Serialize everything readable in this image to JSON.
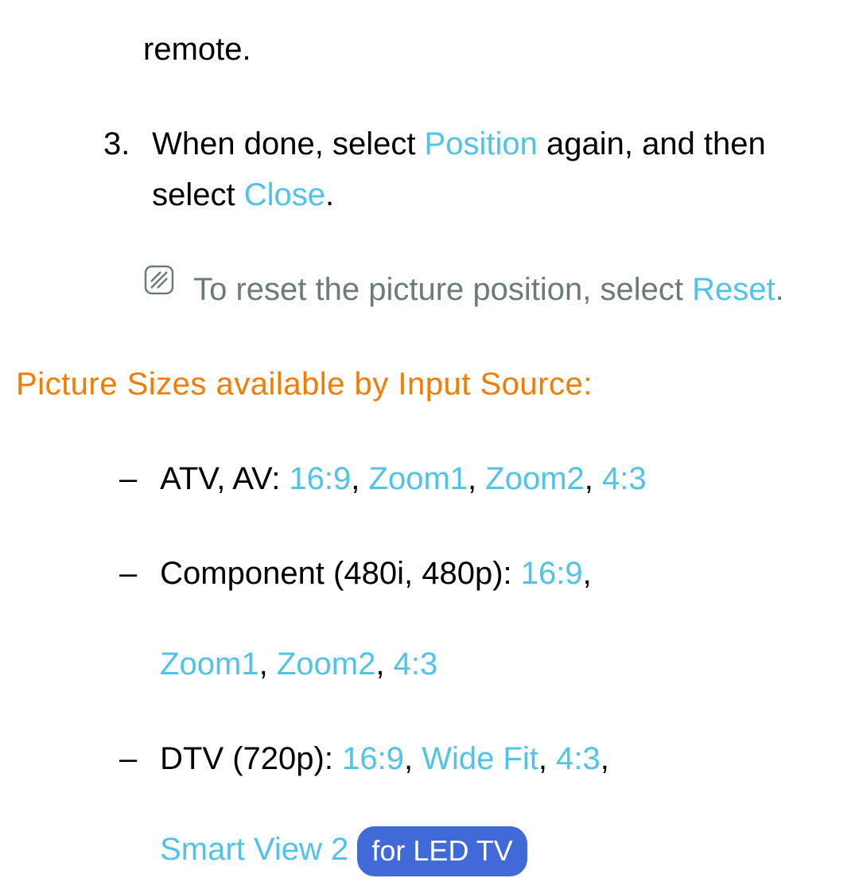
{
  "p0": "remote.",
  "step3_num": "3.",
  "step3_a": "When done, select ",
  "step3_pos": "Position",
  "step3_b": " again, and then select ",
  "step3_close": "Close",
  "step3_c": ".",
  "note_a": "To reset the picture position, select ",
  "note_reset": "Reset",
  "note_b": ".",
  "section_title": "Picture Sizes available by Input Source:",
  "dash": "–",
  "li1_a": "ATV, AV: ",
  "li1_v1": "16:9",
  "sep": ", ",
  "li1_v2": "Zoom1",
  "li1_v3": "Zoom2",
  "li1_v4": "4:3",
  "li2_a": "Component (480i, 480p): ",
  "li2_v1": "16:9",
  "li2_v2": "Zoom1",
  "li2_v3": "Zoom2",
  "li2_v4": "4:3",
  "li3_a": "DTV (720p): ",
  "li3_v1": "16:9",
  "li3_v2": "Wide Fit",
  "li3_v3": "4:3",
  "li3_v4": "Smart View 2",
  "badge": "for LED TV"
}
